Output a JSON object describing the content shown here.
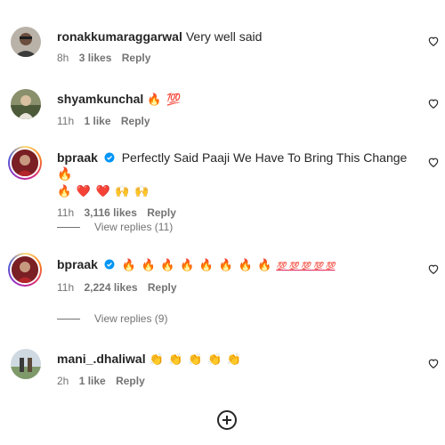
{
  "comments": [
    {
      "username": "ronakkumaraggarwal",
      "text": "Very well said",
      "time": "8h",
      "likes": "3 likes",
      "reply": "Reply"
    },
    {
      "username": "shyamkunchal",
      "text": "🔥 💯",
      "time": "11h",
      "likes": "1 like",
      "reply": "Reply"
    },
    {
      "username": "bpraak",
      "text": "Perfectly Said Paaji We Have To Bring This Change 🔥",
      "text2": "🔥 ❤️ ❤️ 🙌 🙌",
      "time": "11h",
      "likes": "3,116 likes",
      "reply": "Reply",
      "view_replies": "View replies (11)"
    },
    {
      "username": "bpraak",
      "text": "🔥 🔥 🔥 🔥 🔥 🔥 🔥 🔥",
      "text_hundreds": "💯 💯 💯 💯 💯",
      "time": "11h",
      "likes": "2,224 likes",
      "reply": "Reply",
      "view_replies": "View replies (9)"
    },
    {
      "username": "mani_.dhaliwal",
      "text": "👏 👏 👏 👏 👏",
      "time": "2h",
      "likes": "1 like",
      "reply": "Reply"
    }
  ],
  "icons": {
    "like": "heart-outline-icon",
    "verified": "verified-badge-icon",
    "load_more": "plus-circle-icon"
  }
}
